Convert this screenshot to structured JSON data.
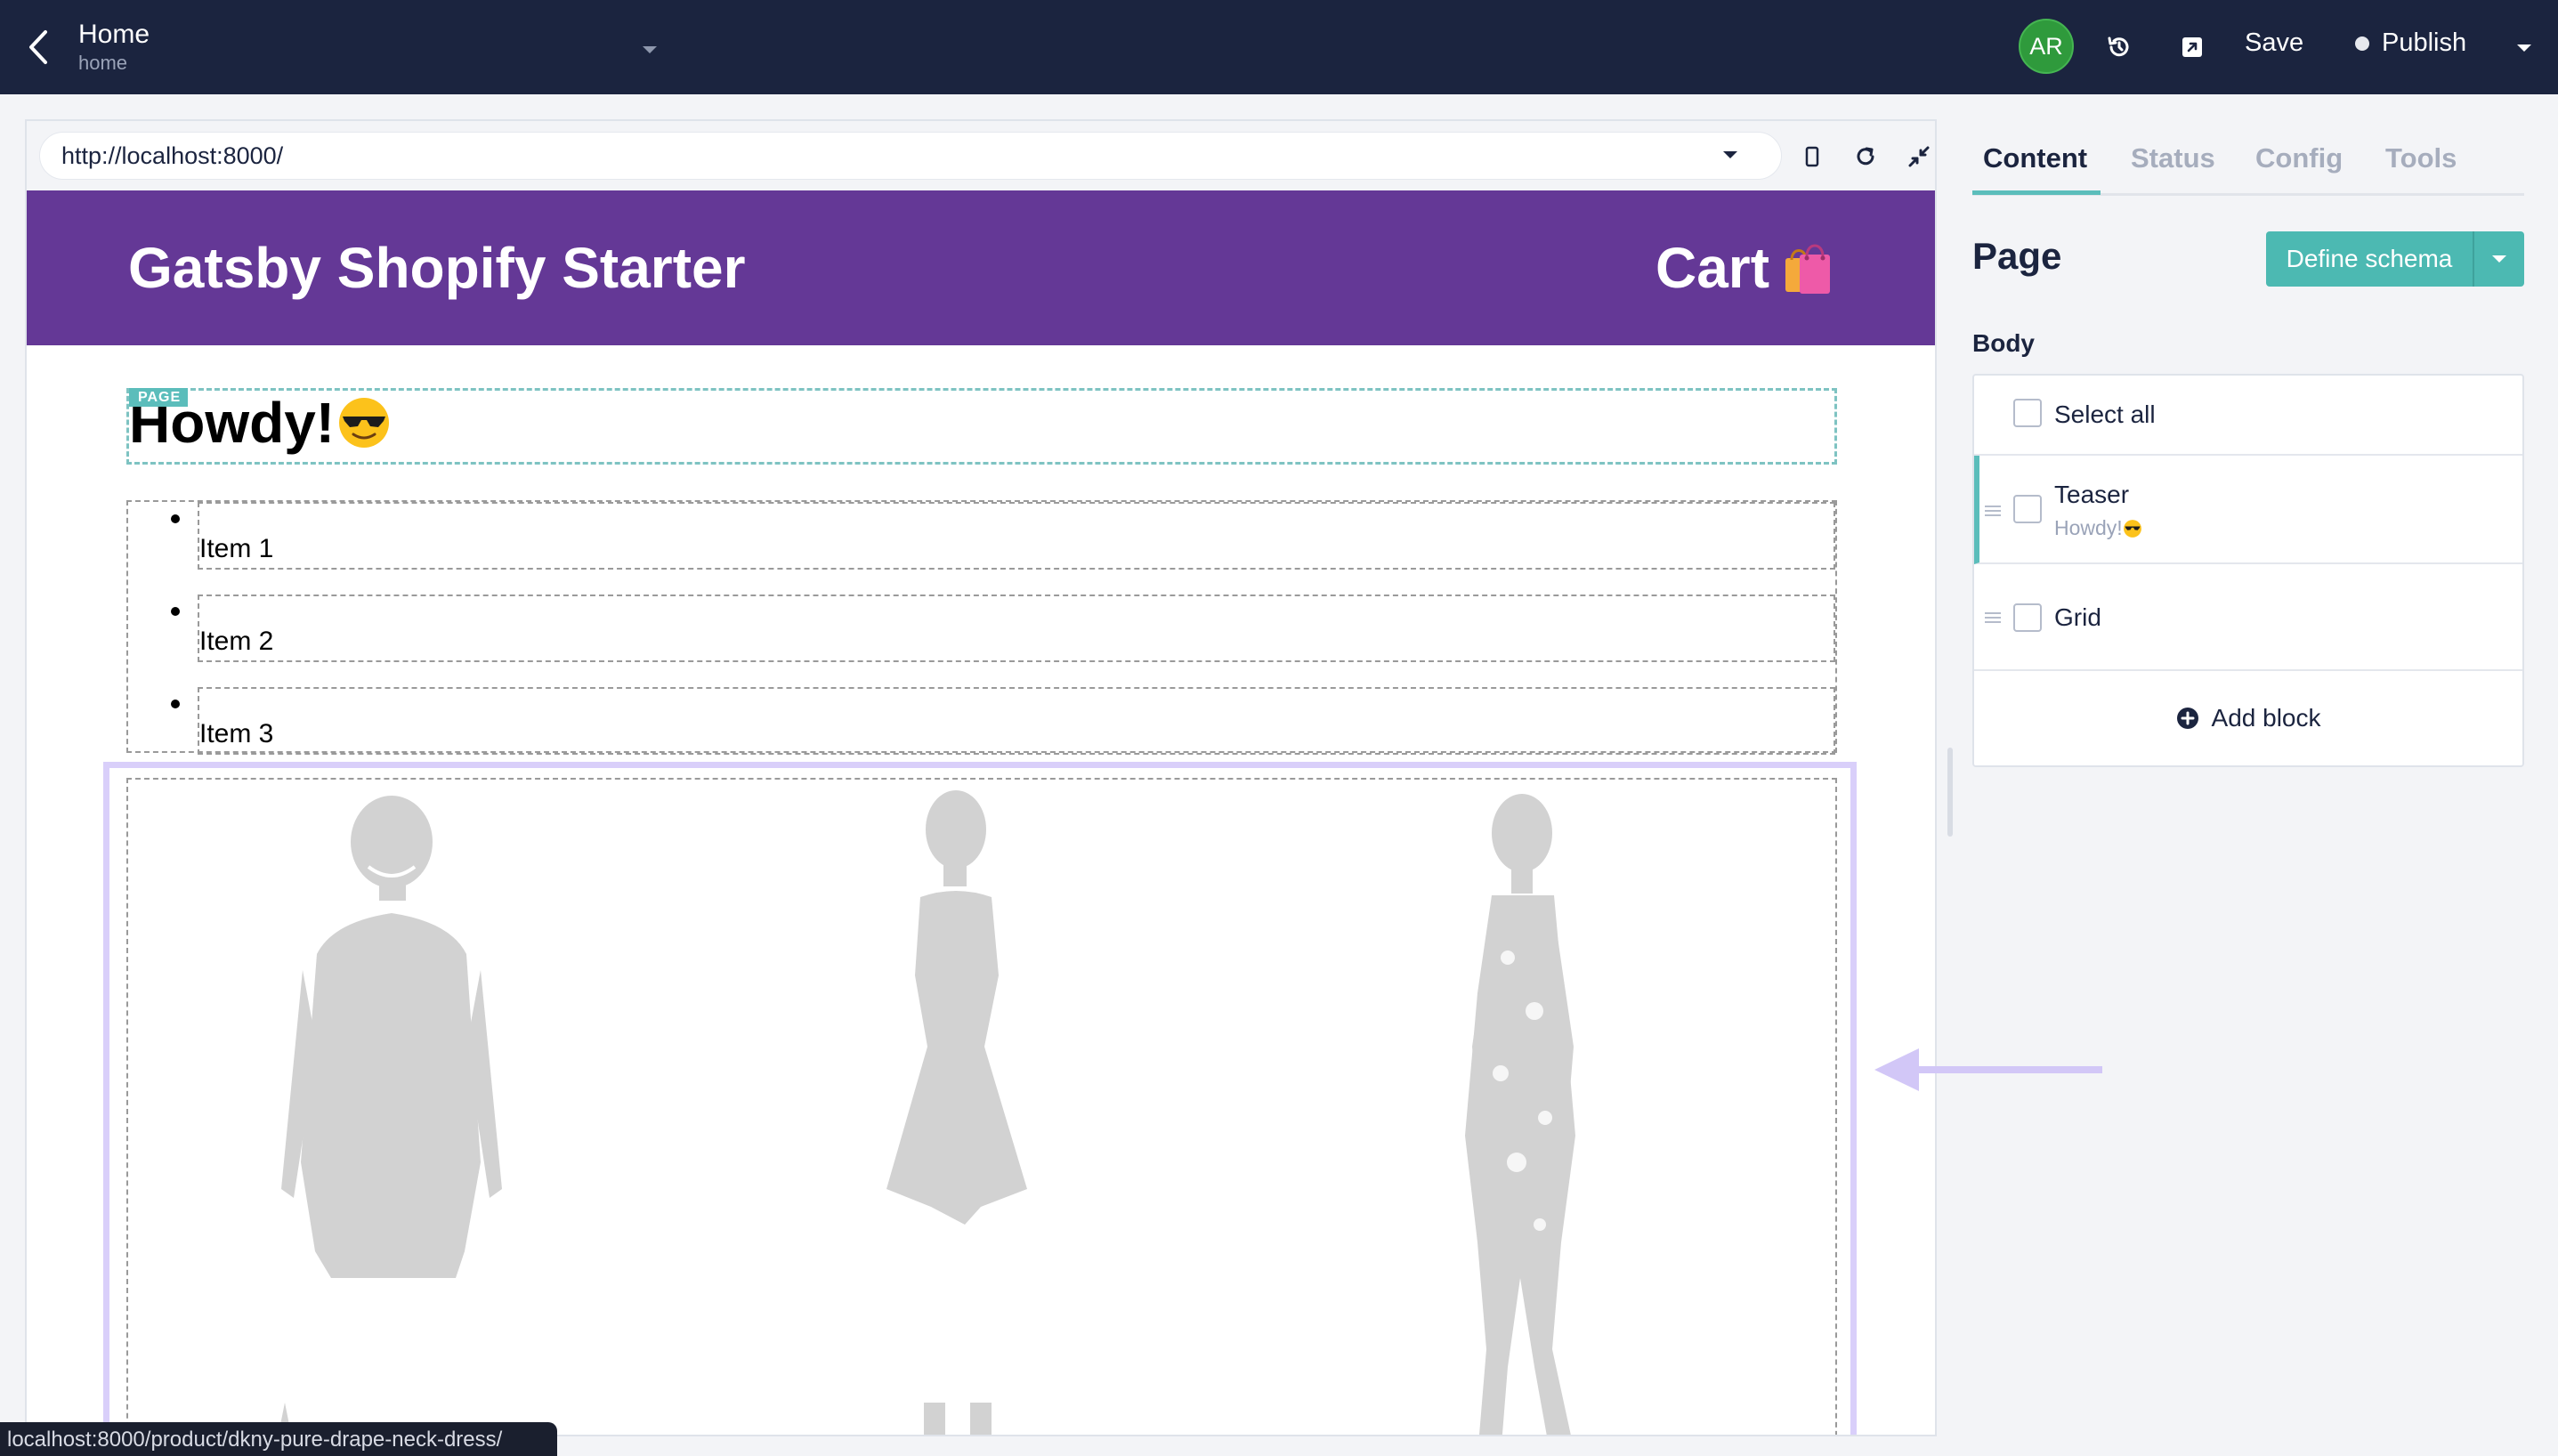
{
  "topbar": {
    "title": "Home",
    "slug": "home",
    "avatar_initials": "AR",
    "save_label": "Save",
    "publish_label": "Publish"
  },
  "preview": {
    "url": "http://localhost:8000/",
    "site_title": "Gatsby Shopify Starter",
    "cart_label": "Cart",
    "teaser_tag": "PAGE",
    "teaser_heading": "Howdy!",
    "list_items": [
      "Item 1",
      "Item 2",
      "Item 3"
    ],
    "status_url": "localhost:8000/product/dkny-pure-drape-neck-dress/"
  },
  "panel": {
    "tabs": [
      "Content",
      "Status",
      "Config",
      "Tools"
    ],
    "active_tab": "Content",
    "page_heading": "Page",
    "define_schema_label": "Define schema",
    "body_label": "Body",
    "select_all_label": "Select all",
    "blocks": [
      {
        "title": "Teaser",
        "subtitle": "Howdy!"
      },
      {
        "title": "Grid"
      }
    ],
    "add_block_label": "Add block"
  },
  "colors": {
    "topbar_bg": "#1b243f",
    "site_header_bg": "#643896",
    "accent_teal": "#4cb9b2",
    "highlight_lavender": "#d9cffa",
    "avatar_green": "#2f9a3c"
  }
}
